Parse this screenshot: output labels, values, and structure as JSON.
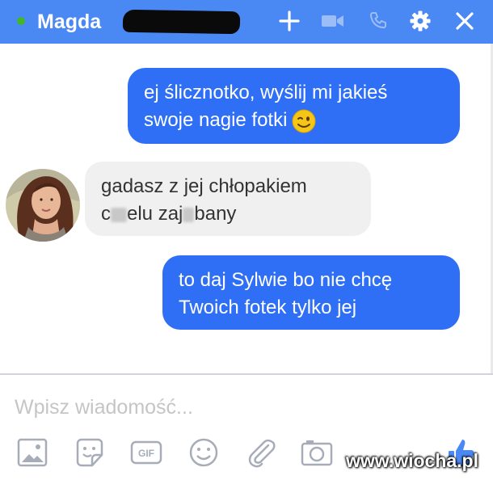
{
  "header": {
    "contact_name": "Magda",
    "icons": [
      "status-online-dot",
      "add-icon",
      "video-call-icon",
      "phone-icon",
      "settings-gear-icon",
      "close-icon"
    ],
    "colors": {
      "bar": "#4a88f3",
      "online": "#42b72a"
    }
  },
  "messages": [
    {
      "sender": "me",
      "lines": [
        "ej ślicznotko, wyślij mi jakieś",
        "swoje nagie fotki"
      ],
      "emoji": "winking-face"
    },
    {
      "sender": "Magda",
      "lines": [
        "gadasz z jej chłopakiem",
        "c",
        "elu zaj",
        "bany"
      ]
    },
    {
      "sender": "me",
      "lines": [
        "to daj Sylwie bo nie chcę",
        "Twoich fotek tylko jej"
      ]
    }
  ],
  "compose": {
    "placeholder": "Wpisz wiadomość..."
  },
  "toolbar": {
    "icons": [
      "image-icon",
      "sticker-icon",
      "gif-icon",
      "emoji-icon",
      "attachment-icon",
      "camera-icon",
      "like-thumb-icon"
    ],
    "gif_label": "GIF"
  },
  "watermark": "www.wiocha.pl",
  "colors": {
    "outgoing_bubble": "#2f6ff5",
    "incoming_bubble": "#f1f0f0"
  }
}
